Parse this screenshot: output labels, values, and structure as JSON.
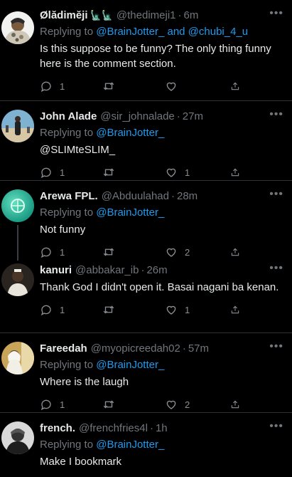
{
  "tweets": [
    {
      "name": "Ølădimĕji",
      "name_icons": "🗽🗽",
      "handle": "@thedimeji1",
      "time": "6m",
      "replying_label": "Replying to",
      "replying_to": "@BrainJotter_ and @chubi_4_u",
      "text": "Is this suppose to be funny? The only thing funny here is the comment section.",
      "reply_count": "1",
      "retweet_count": "",
      "like_count": ""
    },
    {
      "name": "John Alade",
      "handle": "@sir_johnalade",
      "time": "27m",
      "replying_label": "Replying to",
      "replying_to": "@BrainJotter_",
      "text": "@SLIMteSLIM_",
      "reply_count": "1",
      "retweet_count": "",
      "like_count": "1"
    },
    {
      "name": "Arewa FPL.",
      "handle": "@Abduulahad",
      "time": "28m",
      "replying_label": "Replying to",
      "replying_to": "@BrainJotter_",
      "text": "Not funny",
      "reply_count": "1",
      "retweet_count": "",
      "like_count": "2"
    },
    {
      "name": "kanuri",
      "handle": "@abbakar_ib",
      "time": "26m",
      "text": "Thank God I didn't open it. Basai nagani ba kenan.",
      "reply_count": "1",
      "retweet_count": "",
      "like_count": "1"
    },
    {
      "name": "Fareedah",
      "handle": "@myopicreedah02",
      "time": "57m",
      "replying_label": "Replying to",
      "replying_to": "@BrainJotter_",
      "text": "Where is the laugh",
      "reply_count": "1",
      "retweet_count": "",
      "like_count": "2"
    },
    {
      "name": "french.",
      "handle": "@frenchfries4l",
      "time": "1h",
      "replying_label": "Replying to",
      "replying_to": "@BrainJotter_",
      "text": "Make I bookmark"
    }
  ],
  "colors": {
    "background": "#000000",
    "text": "#e7e9ea",
    "muted": "#71767b",
    "link": "#1d9bf0",
    "divider": "#2f3336"
  },
  "icons": {
    "reply": "speech-bubble-icon",
    "retweet": "retweet-arrows-icon",
    "like": "heart-outline-icon",
    "share": "share-upload-icon",
    "more": "more-dots-icon"
  }
}
